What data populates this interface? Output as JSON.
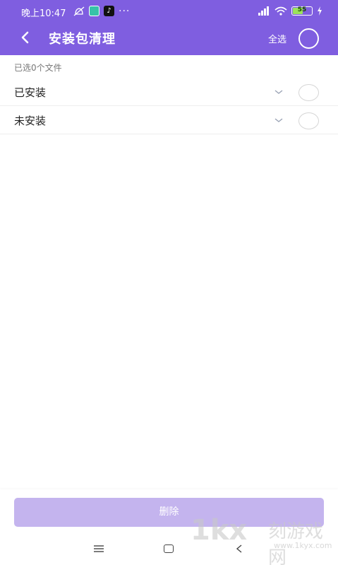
{
  "status_bar": {
    "time": "晚上10:47",
    "more": "···",
    "battery": "55",
    "icons": [
      "notifications-off-icon",
      "app-icon",
      "tiktok-icon",
      "signal-icon",
      "wifi-icon",
      "battery-icon",
      "charging-icon"
    ]
  },
  "header": {
    "title": "安装包清理",
    "select_all": "全选",
    "back_icon": "chevron-left-icon"
  },
  "selection": {
    "count_text": "已选0个文件"
  },
  "groups": [
    {
      "label": "已安装",
      "icon": "chevron-down-icon"
    },
    {
      "label": "未安装",
      "icon": "chevron-down-icon"
    }
  ],
  "footer": {
    "delete_label": "删除"
  },
  "watermark": {
    "logo": "1kx",
    "text": "刻游戏网",
    "url": "www.1kyx.com"
  },
  "colors": {
    "accent": "#7f5ee0",
    "button_disabled": "#c4b4ee"
  }
}
